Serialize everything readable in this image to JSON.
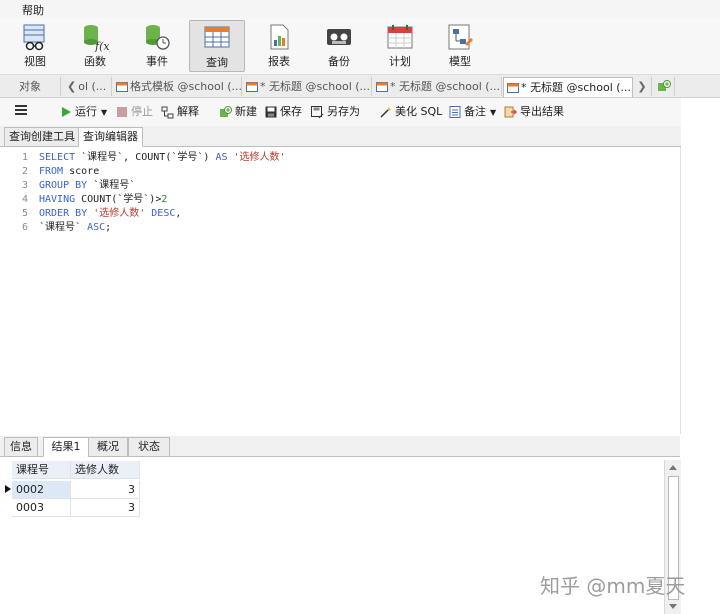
{
  "menu": {
    "help": "帮助"
  },
  "ribbon": [
    {
      "label": "视图",
      "icon": "view-icon"
    },
    {
      "label": "函数",
      "icon": "function-icon"
    },
    {
      "label": "事件",
      "icon": "event-icon"
    },
    {
      "label": "查询",
      "icon": "query-icon"
    },
    {
      "label": "报表",
      "icon": "report-icon"
    },
    {
      "label": "备份",
      "icon": "backup-icon"
    },
    {
      "label": "计划",
      "icon": "schedule-icon"
    },
    {
      "label": "模型",
      "icon": "model-icon"
    }
  ],
  "tabs": {
    "objects": "对象",
    "items": [
      {
        "label": "ol (..."
      },
      {
        "label": "格式模板 @school (..."
      },
      {
        "label": "* 无标题 @school (..."
      },
      {
        "label": "* 无标题 @school (..."
      },
      {
        "label": "* 无标题 @school (..."
      }
    ]
  },
  "toolbar": {
    "run": "运行",
    "stop": "停止",
    "explain": "解释",
    "new": "新建",
    "save": "保存",
    "save_as": "另存为",
    "beautify": "美化 SQL",
    "note": "备注",
    "export": "导出结果"
  },
  "subtabs": {
    "builder": "查询创建工具",
    "editor": "查询编辑器"
  },
  "editor": {
    "lines": [
      {
        "n": "1",
        "parts": [
          {
            "t": "SELECT",
            "c": "kw"
          },
          {
            "t": " `课程号`, COUNT(`学号`) ",
            "c": ""
          },
          {
            "t": "AS",
            "c": "kw"
          },
          {
            "t": " ",
            "c": ""
          },
          {
            "t": "'选修人数'",
            "c": "str"
          }
        ]
      },
      {
        "n": "2",
        "parts": [
          {
            "t": "FROM",
            "c": "kw"
          },
          {
            "t": " score",
            "c": ""
          }
        ]
      },
      {
        "n": "3",
        "parts": [
          {
            "t": "GROUP BY",
            "c": "kw"
          },
          {
            "t": " `课程号`",
            "c": ""
          }
        ]
      },
      {
        "n": "4",
        "parts": [
          {
            "t": "HAVING",
            "c": "kw"
          },
          {
            "t": " COUNT(`学号`)>",
            "c": ""
          },
          {
            "t": "2",
            "c": "num"
          }
        ]
      },
      {
        "n": "5",
        "parts": [
          {
            "t": "ORDER BY",
            "c": "kw"
          },
          {
            "t": " ",
            "c": ""
          },
          {
            "t": "'选修人数'",
            "c": "str"
          },
          {
            "t": " ",
            "c": ""
          },
          {
            "t": "DESC",
            "c": "kw"
          },
          {
            "t": ",",
            "c": ""
          }
        ]
      },
      {
        "n": "6",
        "parts": [
          {
            "t": "`课程号` ",
            "c": ""
          },
          {
            "t": "ASC",
            "c": "kw"
          },
          {
            "t": ";",
            "c": ""
          }
        ]
      }
    ]
  },
  "result_tabs": {
    "info": "信息",
    "result1": "结果1",
    "profile": "概况",
    "status": "状态"
  },
  "result": {
    "columns": [
      "课程号",
      "选修人数"
    ],
    "rows": [
      [
        "0002",
        "3"
      ],
      [
        "0003",
        "3"
      ]
    ]
  },
  "watermark": "知乎 @mm夏天"
}
